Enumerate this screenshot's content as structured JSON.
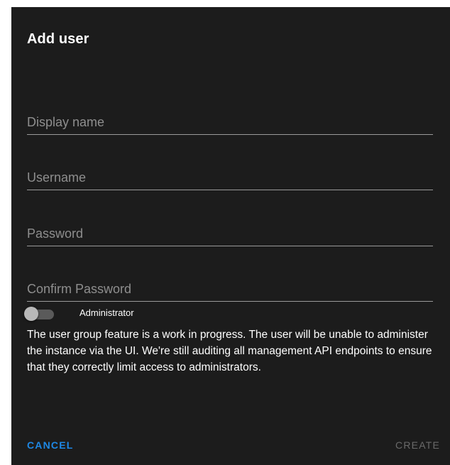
{
  "dialog": {
    "title": "Add user",
    "fields": {
      "display_name": {
        "placeholder": "Display name",
        "value": ""
      },
      "username": {
        "placeholder": "Username",
        "value": ""
      },
      "password": {
        "placeholder": "Password",
        "value": ""
      },
      "confirm_password": {
        "placeholder": "Confirm Password",
        "value": ""
      }
    },
    "admin_toggle": {
      "label": "Administrator",
      "checked": false
    },
    "note": "The user group feature is a work in progress. The user will be unable to administer the instance via the UI. We're still auditing all management API endpoints to ensure that they correctly limit access to administrators.",
    "actions": {
      "cancel_label": "CANCEL",
      "create_label": "CREATE"
    }
  },
  "colors": {
    "dialog_bg": "#1c1c1c",
    "accent": "#1e88e5",
    "disabled": "#6a6a6a"
  }
}
